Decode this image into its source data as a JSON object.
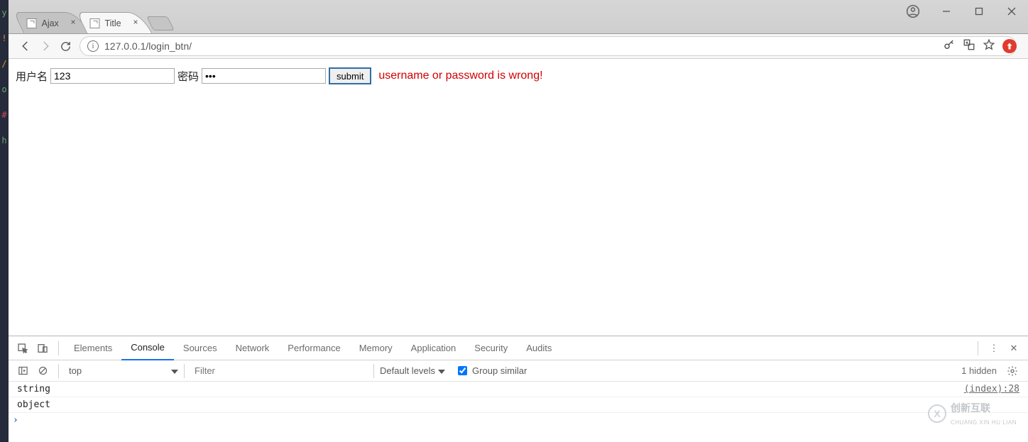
{
  "left_strip": [
    "y",
    "!",
    " ",
    "/",
    "o",
    "#",
    "h",
    " "
  ],
  "window": {
    "tabs": [
      {
        "title": "Ajax",
        "active": false
      },
      {
        "title": "Title",
        "active": true
      }
    ],
    "controls": {
      "account": "account",
      "min": "—",
      "max": "▢",
      "close": "✕"
    }
  },
  "addressbar": {
    "url": "127.0.0.1/login_btn/",
    "icons": {
      "key": "⚿",
      "translate": "🈂",
      "star": "☆",
      "ext": "⬆"
    }
  },
  "page": {
    "username_label": "用户名",
    "username_value": "123",
    "password_label": "密码",
    "password_value": "•••",
    "submit_label": "submit",
    "error_msg": "username or password is wrong!"
  },
  "devtools": {
    "tabs": [
      "Elements",
      "Console",
      "Sources",
      "Network",
      "Performance",
      "Memory",
      "Application",
      "Security",
      "Audits"
    ],
    "active_tab": "Console",
    "context": "top",
    "filter_placeholder": "Filter",
    "levels_label": "Default levels",
    "group_label": "Group similar",
    "group_checked": true,
    "hidden_label": "1 hidden",
    "logs": [
      {
        "msg": "string",
        "src": "(index):28"
      },
      {
        "msg": "object",
        "src": ""
      }
    ]
  },
  "watermark": {
    "logo": "X",
    "text": "创新互联",
    "sub": "CHUANG XIN HU LIAN"
  }
}
